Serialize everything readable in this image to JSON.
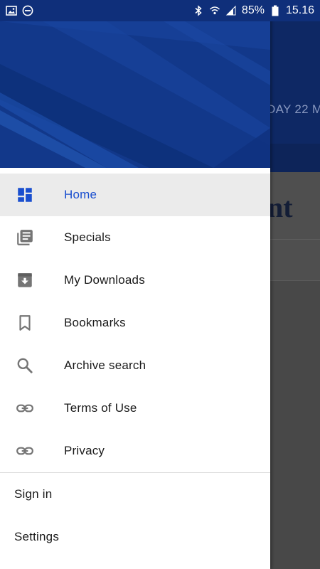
{
  "status_bar": {
    "left_icons": [
      "image-icon",
      "do-not-disturb-icon"
    ],
    "right_icons": [
      "bluetooth-icon",
      "wifi-icon",
      "signal-icon",
      "battery-icon"
    ],
    "battery": "85%",
    "time": "15.16"
  },
  "background": {
    "date_fragment": "IDAY 22 M",
    "logo_fragment": "nt"
  },
  "drawer": {
    "menu": [
      {
        "label": "Home",
        "icon": "dashboard-icon",
        "active": true
      },
      {
        "label": "Specials",
        "icon": "library-icon",
        "active": false
      },
      {
        "label": "My Downloads",
        "icon": "download-box-icon",
        "active": false
      },
      {
        "label": "Bookmarks",
        "icon": "bookmark-icon",
        "active": false
      },
      {
        "label": "Archive search",
        "icon": "search-icon",
        "active": false
      },
      {
        "label": "Terms of Use",
        "icon": "link-icon",
        "active": false
      },
      {
        "label": "Privacy",
        "icon": "link-icon",
        "active": false
      }
    ],
    "bottom": [
      {
        "label": "Sign in"
      },
      {
        "label": "Settings"
      }
    ]
  },
  "colors": {
    "header_blue": "#123a8e",
    "active_text": "#1a4fcf",
    "icon_gray": "#757575",
    "active_bg": "#ebebeb"
  }
}
